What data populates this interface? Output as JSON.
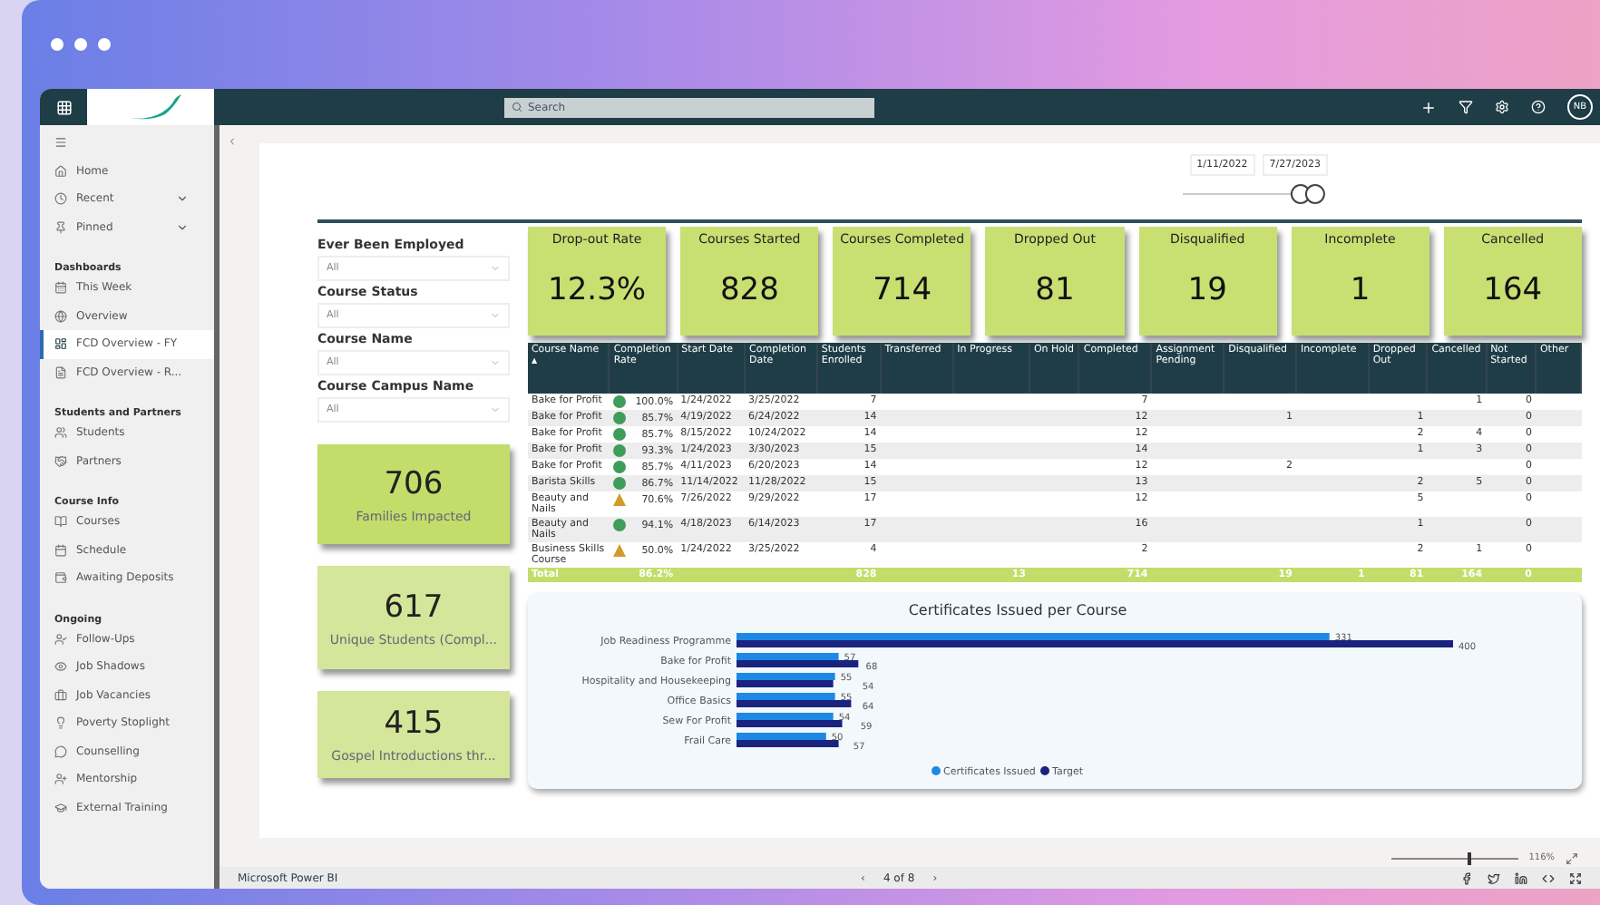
{
  "app_bar": {
    "search": {
      "placeholder": "Search"
    },
    "avatar": "NB"
  },
  "sidebar": {
    "items": [
      {
        "kind": "nav",
        "label": "Home",
        "selected": false
      },
      {
        "kind": "expandable",
        "label": "Recent",
        "selected": false,
        "expanded": false
      },
      {
        "kind": "expandable",
        "label": "Pinned",
        "selected": false,
        "expanded": false
      },
      {
        "kind": "section",
        "label": "Dashboards"
      },
      {
        "kind": "nav",
        "label": "This Week",
        "selected": false
      },
      {
        "kind": "nav",
        "label": "Overview",
        "selected": false
      },
      {
        "kind": "nav",
        "label": "FCD Overview - FY",
        "selected": true
      },
      {
        "kind": "nav",
        "label": "FCD Overview - R...",
        "selected": false
      },
      {
        "kind": "section",
        "label": "Students and Partners"
      },
      {
        "kind": "nav",
        "label": "Students",
        "selected": false
      },
      {
        "kind": "nav",
        "label": "Partners",
        "selected": false
      },
      {
        "kind": "section",
        "label": "Course Info"
      },
      {
        "kind": "nav",
        "label": "Courses",
        "selected": false
      },
      {
        "kind": "nav",
        "label": "Schedule",
        "selected": false
      },
      {
        "kind": "nav",
        "label": "Awaiting Deposits",
        "selected": false
      },
      {
        "kind": "section",
        "label": "Ongoing"
      },
      {
        "kind": "nav",
        "label": "Follow-Ups",
        "selected": false
      },
      {
        "kind": "nav",
        "label": "Job Shadows",
        "selected": false
      },
      {
        "kind": "nav",
        "label": "Job Vacancies",
        "selected": false
      },
      {
        "kind": "nav",
        "label": "Poverty Stoplight",
        "selected": false
      },
      {
        "kind": "nav",
        "label": "Counselling",
        "selected": false
      },
      {
        "kind": "nav",
        "label": "Mentorship",
        "selected": false
      },
      {
        "kind": "nav",
        "label": "External Training",
        "selected": false
      }
    ]
  },
  "date_range": {
    "start": "1/11/2022",
    "end": "7/27/2023",
    "slider": {
      "level": 0.88
    }
  },
  "slicers": [
    {
      "label": "Ever Been Employed",
      "value": "All"
    },
    {
      "label": "Course Status",
      "value": "All"
    },
    {
      "label": "Course Name",
      "value": "All"
    },
    {
      "label": "Course Campus Name",
      "value": "All"
    }
  ],
  "side_cards": [
    {
      "value": "706",
      "label": "Families Impacted"
    },
    {
      "value": "617",
      "label": "Unique Students (Compl..."
    },
    {
      "value": "415",
      "label": "Gospel Introductions thr..."
    }
  ],
  "kpis": [
    {
      "label": "Drop-out Rate",
      "value": "12.3%"
    },
    {
      "label": "Courses Started",
      "value": "828"
    },
    {
      "label": "Courses Completed",
      "value": "714"
    },
    {
      "label": "Dropped Out",
      "value": "81"
    },
    {
      "label": "Disqualified",
      "value": "19"
    },
    {
      "label": "Incomplete",
      "value": "1"
    },
    {
      "label": "Cancelled",
      "value": "164"
    }
  ],
  "table": {
    "sort_mark": "▲",
    "columns": [
      "Course Name",
      "Completion Rate",
      "Start Date",
      "Completion Date",
      "Students Enrolled",
      "Transferred",
      "In Progress",
      "On Hold",
      "Completed",
      "Assignment Pending",
      "Disqualified",
      "Incomplete",
      "Dropped Out",
      "Cancelled",
      "Not Started",
      "Other"
    ],
    "rows": [
      {
        "kind": "ok",
        "name": "Bake for Profit",
        "rate": "100.0%",
        "start": "1/24/2022",
        "end": "3/25/2022",
        "enrolled": "7",
        "completed": "7",
        "cancelled": "1",
        "not_started": "0"
      },
      {
        "kind": "ok",
        "name": "Bake for Profit",
        "rate": "85.7%",
        "start": "4/19/2022",
        "end": "6/24/2022",
        "enrolled": "14",
        "completed": "12",
        "disqualified": "1",
        "dropped": "1",
        "not_started": "0"
      },
      {
        "kind": "ok",
        "name": "Bake for Profit",
        "rate": "85.7%",
        "start": "8/15/2022",
        "end": "10/24/2022",
        "enrolled": "14",
        "completed": "12",
        "dropped": "2",
        "cancelled": "4",
        "not_started": "0"
      },
      {
        "kind": "ok",
        "name": "Bake for Profit",
        "rate": "93.3%",
        "start": "1/24/2023",
        "end": "3/30/2023",
        "enrolled": "15",
        "completed": "14",
        "dropped": "1",
        "cancelled": "3",
        "not_started": "0"
      },
      {
        "kind": "ok",
        "name": "Bake for Profit",
        "rate": "85.7%",
        "start": "4/11/2023",
        "end": "6/20/2023",
        "enrolled": "14",
        "completed": "12",
        "disqualified": "2",
        "not_started": "0"
      },
      {
        "kind": "ok",
        "name": "Barista Skills",
        "rate": "86.7%",
        "start": "11/14/2022",
        "end": "11/28/2022",
        "enrolled": "15",
        "completed": "13",
        "dropped": "2",
        "cancelled": "5",
        "not_started": "0"
      },
      {
        "kind": "warning",
        "name": "Beauty and Nails",
        "rate": "70.6%",
        "start": "7/26/2022",
        "end": "9/29/2022",
        "enrolled": "17",
        "completed": "12",
        "dropped": "5",
        "not_started": "0"
      },
      {
        "kind": "ok",
        "name": "Beauty and Nails",
        "rate": "94.1%",
        "start": "4/18/2023",
        "end": "6/14/2023",
        "enrolled": "17",
        "completed": "16",
        "dropped": "1",
        "not_started": "0"
      },
      {
        "kind": "warning",
        "name": "Business Skills Course",
        "rate": "50.0%",
        "start": "1/24/2022",
        "end": "3/25/2022",
        "enrolled": "4",
        "completed": "2",
        "dropped": "2",
        "cancelled": "1",
        "not_started": "0"
      }
    ],
    "total": {
      "name": "Total",
      "rate": "86.2%",
      "enrolled": "828",
      "in_progress": "13",
      "completed": "714",
      "disqualified": "19",
      "incomplete": "1",
      "dropped": "81",
      "cancelled": "164",
      "not_started": "0"
    }
  },
  "chart": {
    "chart_data": {
      "type": "bar",
      "orientation": "horizontal",
      "title": "Certificates Issued per Course",
      "categories": [
        "Job Readiness Programme",
        "Bake for Profit",
        "Hospitality and Housekeeping",
        "Office Basics",
        "Sew For Profit",
        "Frail Care"
      ],
      "series": [
        {
          "name": "Certificates Issued",
          "color": "#1e88e5",
          "values": [
            331,
            57,
            55,
            55,
            54,
            50
          ]
        },
        {
          "name": "Target",
          "color": "#1a237e",
          "values": [
            400,
            68,
            54,
            64,
            59,
            57
          ]
        }
      ],
      "data_labels": true,
      "legend": "bottom"
    }
  },
  "footer": {
    "brand": "Microsoft Power BI",
    "page": "4 of 8",
    "prev": "‹",
    "next": "›",
    "zoom": "116%",
    "zoom_slider": {
      "level": 0.6
    }
  }
}
